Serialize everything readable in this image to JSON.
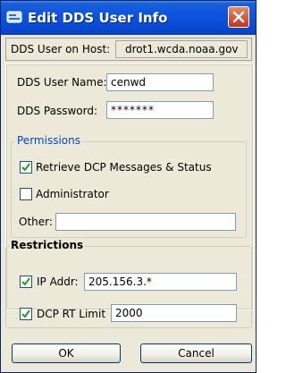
{
  "window": {
    "title": "Edit DDS User Info"
  },
  "host": {
    "label": "DDS User on Host:",
    "value": "drot1.wcda.noaa.gov"
  },
  "user": {
    "name_label": "DDS User Name:",
    "name_value": "cenwd",
    "password_label": "DDS Password:",
    "password_value": "*******"
  },
  "permissions": {
    "title": "Permissions",
    "retrieve_label": "Retrieve DCP Messages & Status",
    "retrieve_checked": true,
    "admin_label": "Administrator",
    "admin_checked": false,
    "other_label": "Other:",
    "other_value": ""
  },
  "restrictions": {
    "title": "Restrictions",
    "ip_label": "IP Addr:",
    "ip_checked": true,
    "ip_value": "205.156.3.*",
    "dcp_label": "DCP RT Limit",
    "dcp_checked": true,
    "dcp_value": "2000"
  },
  "buttons": {
    "ok": "OK",
    "cancel": "Cancel"
  },
  "colors": {
    "titlebar": "#0a4cd6",
    "window_bg": "#ece9d8",
    "close_button": "#c2351a",
    "group_title": "#0046d5",
    "checkmark": "#21a121"
  }
}
